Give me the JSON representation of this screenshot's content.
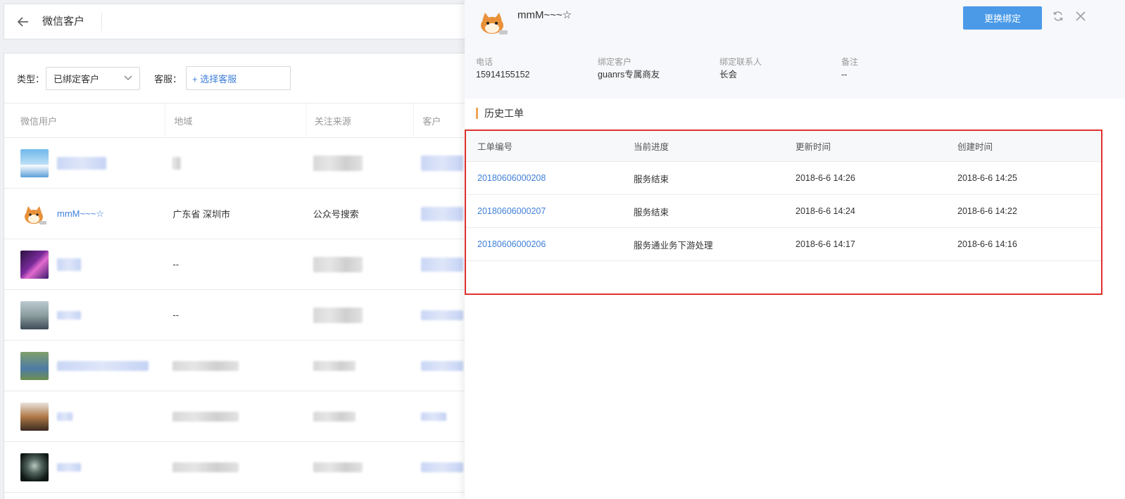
{
  "header": {
    "title": "微信客户"
  },
  "filters": {
    "type_label": "类型：",
    "type_value": "已绑定客户",
    "agent_label": "客服：",
    "agent_placeholder": "+ 选择客服"
  },
  "table": {
    "columns": [
      "微信用户",
      "地域",
      "关注来源",
      "客户"
    ],
    "rows": [
      {
        "name": "",
        "region": "",
        "source": ""
      },
      {
        "name": "mmM~~~☆",
        "region": "广东省 深圳市",
        "source": "公众号搜索"
      },
      {
        "name": "",
        "region": "--",
        "source": ""
      },
      {
        "name": "",
        "region": "--",
        "source": ""
      },
      {
        "name": "",
        "region": "",
        "source": ""
      },
      {
        "name": "",
        "region": "",
        "source": ""
      },
      {
        "name": "",
        "region": "",
        "source": ""
      }
    ]
  },
  "drawer": {
    "name": "mmM~~~☆",
    "rebind_label": "更换绑定",
    "info": [
      {
        "label": "电话",
        "value": "15914155152"
      },
      {
        "label": "绑定客户",
        "value": "guanrs专属商友"
      },
      {
        "label": "绑定联系人",
        "value": "长会"
      },
      {
        "label": "备注",
        "value": "--"
      }
    ],
    "history_title": "历史工单",
    "ticket_columns": [
      "工单编号",
      "当前进度",
      "更新时间",
      "创建时间"
    ],
    "tickets": [
      {
        "id": "20180606000208",
        "status": "服务结束",
        "updated": "2018-6-6 14:26",
        "created": "2018-6-6 14:25"
      },
      {
        "id": "20180606000207",
        "status": "服务结束",
        "updated": "2018-6-6 14:24",
        "created": "2018-6-6 14:22"
      },
      {
        "id": "20180606000206",
        "status": "服务通业务下游处理",
        "updated": "2018-6-6 14:17",
        "created": "2018-6-6 14:16"
      }
    ]
  },
  "colors": {
    "primary": "#4a9ae8",
    "link": "#3f7fd9",
    "accent_bar": "#f0a45a",
    "highlight_border": "#e03131"
  }
}
